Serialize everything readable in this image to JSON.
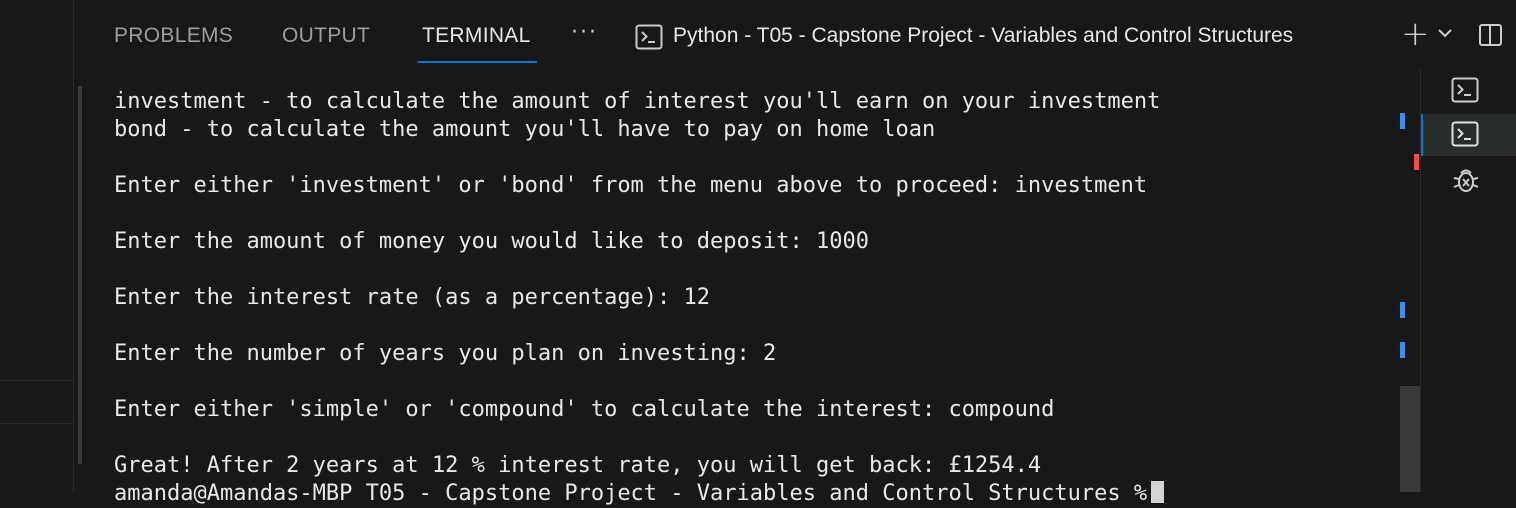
{
  "tabs": [
    {
      "label": "PROBLEMS",
      "active": false
    },
    {
      "label": "OUTPUT",
      "active": false
    },
    {
      "label": "TERMINAL",
      "active": true
    }
  ],
  "toolbar": {
    "more_label": "···",
    "terminal_title": "Python - T05 - Capstone Project - Variables and Control Structures",
    "add_icon": "plus-icon",
    "dropdown_icon": "chevron-down-icon",
    "split_icon": "split-panel-icon"
  },
  "terminal": {
    "lines": [
      "investment - to calculate the amount of interest you'll earn on your investment",
      "bond - to calculate the amount you'll have to pay on home loan",
      "",
      "Enter either 'investment' or 'bond' from the menu above to proceed: investment",
      "",
      "Enter the amount of money you would like to deposit: 1000",
      "",
      "Enter the interest rate (as a percentage): 12",
      "",
      "Enter the number of years you plan on investing: 2",
      "",
      "Enter either 'simple' or 'compound' to calculate the interest: compound",
      "",
      "Great! After 2 years at 12 % interest rate, you will get back: £1254.4",
      "amanda@Amandas-MBP T05 - Capstone Project - Variables and Control Structures %"
    ]
  },
  "side_panel": {
    "items": [
      {
        "icon": "terminal-icon",
        "active": false
      },
      {
        "icon": "terminal-icon",
        "active": true
      },
      {
        "icon": "debug-bug-icon",
        "active": false
      }
    ]
  },
  "colors": {
    "accent": "#0078d4",
    "background": "#181818",
    "scroll_marker_blue": "#3b8eea",
    "scroll_marker_red": "#f14c4c"
  }
}
